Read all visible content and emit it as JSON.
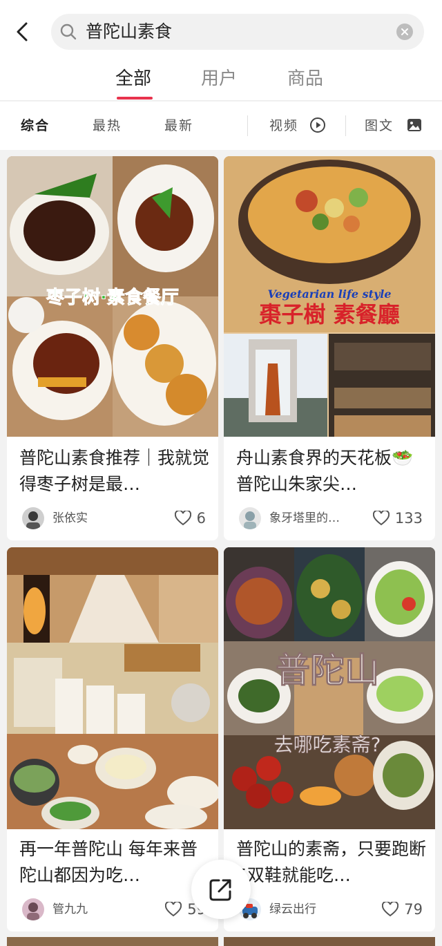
{
  "search": {
    "query": "普陀山素食"
  },
  "tabs": [
    {
      "label": "全部",
      "active": true
    },
    {
      "label": "用户",
      "active": false
    },
    {
      "label": "商品",
      "active": false
    }
  ],
  "filters": {
    "sort": [
      {
        "label": "综合",
        "active": true
      },
      {
        "label": "最热",
        "active": false
      },
      {
        "label": "最新",
        "active": false
      }
    ],
    "video": {
      "label": "视频",
      "icon": "play-circle-icon"
    },
    "image_text": {
      "label": "图文",
      "icon": "image-icon"
    }
  },
  "cards": [
    {
      "title": "普陀山素食推荐｜我就觉得枣子树是最…",
      "author": "张依实",
      "likes": "6",
      "overlay_text": "枣子树·素食餐厅"
    },
    {
      "title": "舟山素食界的天花板🥗普陀山朱家尖…",
      "author": "象牙塔里的…",
      "likes": "133",
      "overlay_text_en": "Vegetarian life style",
      "overlay_text": "棗子樹 素餐廳"
    },
    {
      "title": "再一年普陀山 每年来普陀山都因为吃…",
      "author": "管九九",
      "likes": "59"
    },
    {
      "title": "普陀山的素斋，只要跑断5双鞋就能吃…",
      "author": "绿云出行",
      "likes": "79",
      "overlay_title": "普陀山",
      "overlay_sub": "去哪吃素斋?"
    }
  ],
  "colors": {
    "accent": "#e8334d",
    "background": "#f2f2f2"
  }
}
